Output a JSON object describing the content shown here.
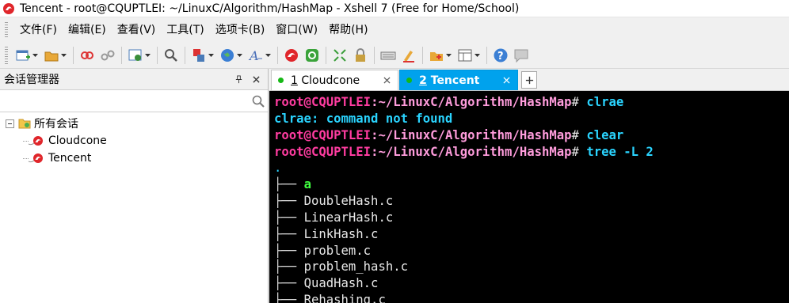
{
  "window": {
    "title": "Tencent - root@CQUPTLEI: ~/LinuxC/Algorithm/HashMap - Xshell 7 (Free for Home/School)",
    "accent_color": "#00a2ed"
  },
  "menu": {
    "items": [
      "文件(F)",
      "编辑(E)",
      "查看(V)",
      "工具(T)",
      "选项卡(B)",
      "窗口(W)",
      "帮助(H)"
    ]
  },
  "toolbar": {
    "icons": [
      "new-session-icon",
      "open-folder-icon",
      "connect-icon",
      "disconnect-icon",
      "properties-icon",
      "find-icon",
      "transfer-icon",
      "globe-icon",
      "font-icon",
      "xshell-icon",
      "xftp-icon",
      "fullscreen-icon",
      "lock-icon",
      "keyboard-icon",
      "highlight-icon",
      "new-tab-icon",
      "layout-icon",
      "help-icon",
      "chat-icon"
    ]
  },
  "session_manager": {
    "title": "会话管理器",
    "search_placeholder": "",
    "root_folder": "所有会话",
    "sessions": [
      "Cloudcone",
      "Tencent"
    ]
  },
  "tabs": [
    {
      "number": "1",
      "label": "Cloudcone",
      "active": false,
      "status_color": "#16b816"
    },
    {
      "number": "2",
      "label": "Tencent",
      "active": true,
      "status_color": "#16b816"
    }
  ],
  "terminal": {
    "prompt_user": "root@CQUPTLEI",
    "prompt_path": ":~/LinuxC/Algorithm/HashMap",
    "prompt_symbol": "#",
    "commands": [
      "clrae",
      "clear",
      "tree -L 2"
    ],
    "error_line": "clrae: command not found",
    "tree_root": ".",
    "tree_entries": [
      "a",
      "DoubleHash.c",
      "LinearHash.c",
      "LinkHash.c",
      "problem.c",
      "problem_hash.c",
      "QuadHash.c",
      "Rehashing.c"
    ],
    "tree_branch": "├── "
  }
}
